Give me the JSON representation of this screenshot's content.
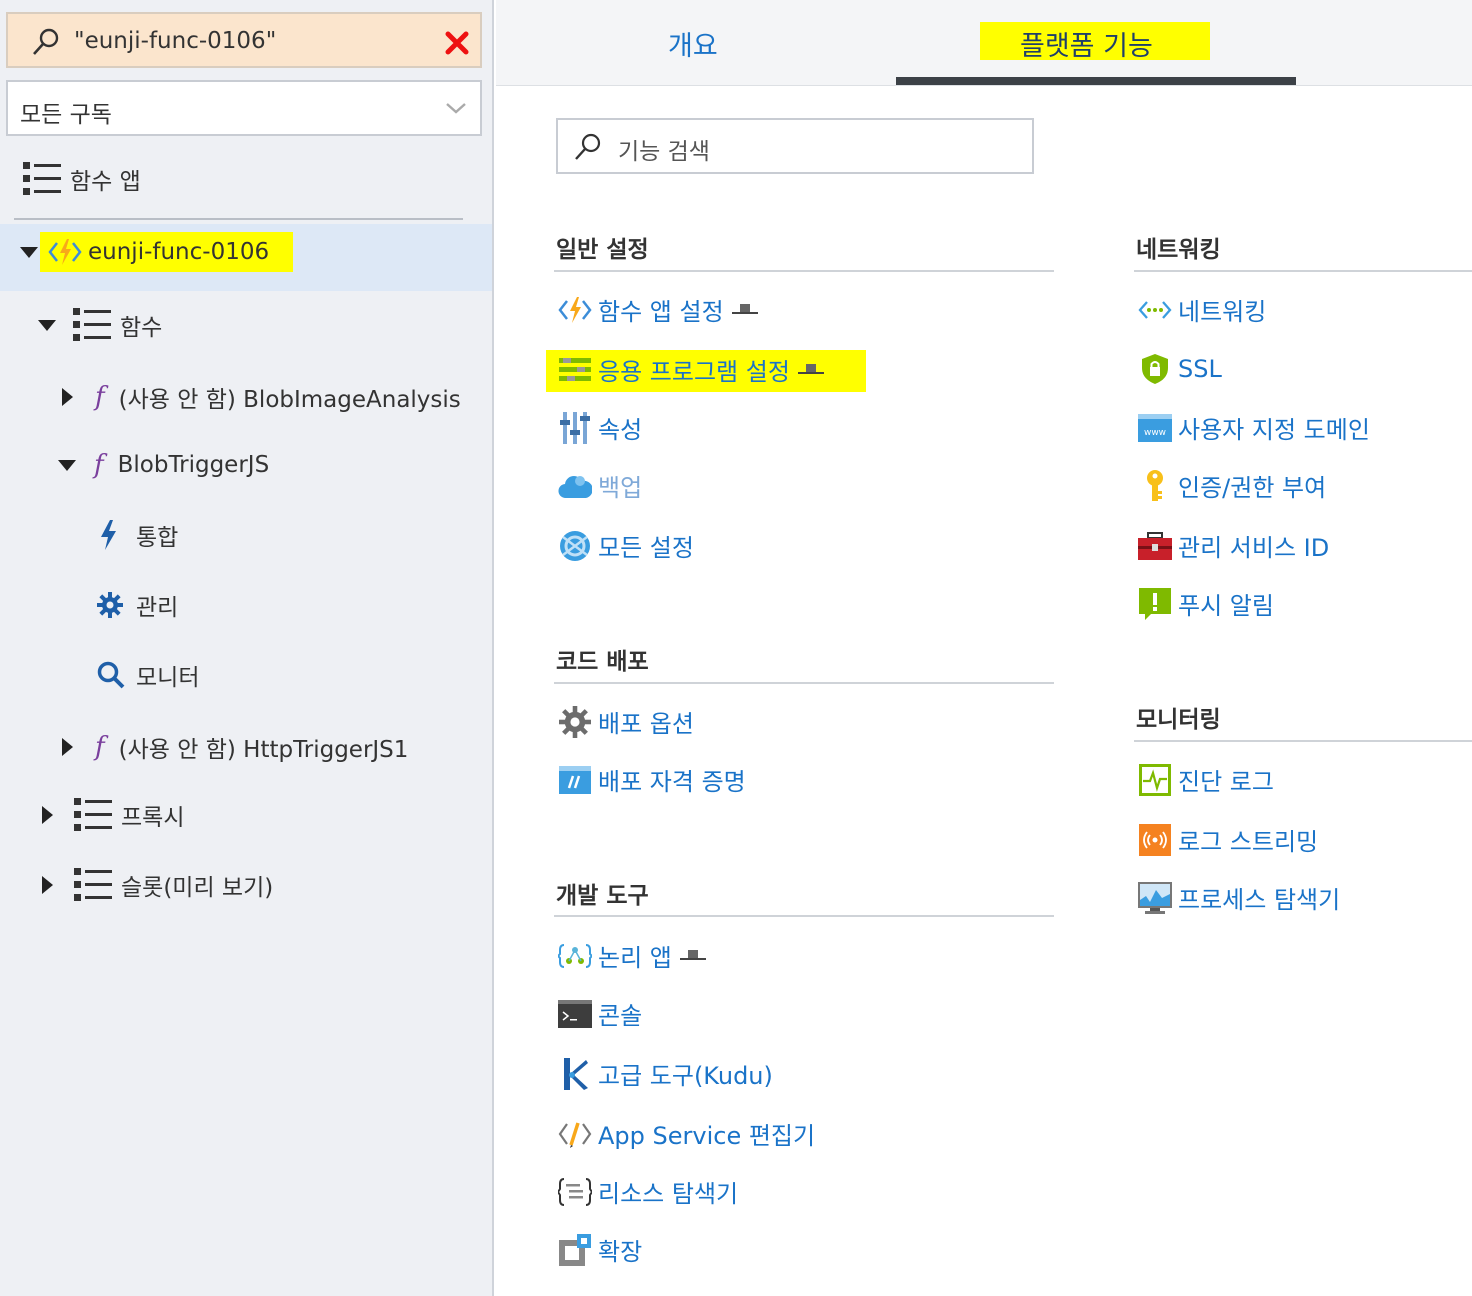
{
  "search": {
    "value": "\"eunji-func-0106\""
  },
  "subscription": {
    "selected": "모든 구독"
  },
  "tree": {
    "root_label": "함수 앱",
    "app_name": "eunji-func-0106",
    "functions_label": "함수",
    "functions": [
      {
        "label": "(사용 안 함) BlobImageAnalysis"
      },
      {
        "label": "BlobTriggerJS"
      },
      {
        "label": "(사용 안 함) HttpTriggerJS1"
      }
    ],
    "function_children": [
      {
        "label": "통합",
        "icon": "lightning-icon"
      },
      {
        "label": "관리",
        "icon": "gear-icon"
      },
      {
        "label": "모니터",
        "icon": "search-icon"
      }
    ],
    "proxies_label": "프록시",
    "slots_label": "슬롯(미리 보기)"
  },
  "tabs": {
    "overview": "개요",
    "platform": "플랫폼 기능"
  },
  "feature_search": {
    "placeholder": "기능 검색"
  },
  "sections": {
    "general": {
      "title": "일반 설정",
      "items": [
        {
          "label": "함수 앱 설정",
          "icon": "function-app-icon"
        },
        {
          "label": "응용 프로그램 설정",
          "icon": "app-settings-icon"
        },
        {
          "label": "속성",
          "icon": "properties-icon"
        },
        {
          "label": "백업",
          "icon": "backup-cloud-icon"
        },
        {
          "label": "모든 설정",
          "icon": "all-settings-icon"
        }
      ]
    },
    "deploy": {
      "title": "코드 배포",
      "items": [
        {
          "label": "배포 옵션",
          "icon": "deploy-gear-icon"
        },
        {
          "label": "배포 자격 증명",
          "icon": "credentials-icon"
        }
      ]
    },
    "devtools": {
      "title": "개발 도구",
      "items": [
        {
          "label": "논리 앱",
          "icon": "logic-app-icon"
        },
        {
          "label": "콘솔",
          "icon": "console-icon"
        },
        {
          "label": "고급 도구(Kudu)",
          "icon": "kudu-icon"
        },
        {
          "label": "App Service 편집기",
          "icon": "editor-icon"
        },
        {
          "label": "리소스 탐색기",
          "icon": "resource-explorer-icon"
        },
        {
          "label": "확장",
          "icon": "extensions-icon"
        }
      ]
    },
    "networking": {
      "title": "네트워킹",
      "items": [
        {
          "label": "네트워킹",
          "icon": "networking-icon"
        },
        {
          "label": "SSL",
          "icon": "ssl-shield-icon"
        },
        {
          "label": "사용자 지정 도메인",
          "icon": "www-icon"
        },
        {
          "label": "인증/권한 부여",
          "icon": "key-icon"
        },
        {
          "label": "관리 서비스 ID",
          "icon": "toolbox-icon"
        },
        {
          "label": "푸시 알림",
          "icon": "push-notification-icon"
        }
      ]
    },
    "monitoring": {
      "title": "모니터링",
      "items": [
        {
          "label": "진단 로그",
          "icon": "diagnostic-logs-icon"
        },
        {
          "label": "로그 스트리밍",
          "icon": "log-streaming-icon"
        },
        {
          "label": "프로세스 탐색기",
          "icon": "process-explorer-icon"
        }
      ]
    }
  },
  "colors": {
    "link": "#1a73c8",
    "highlight": "#ffff00",
    "selected_row": "#dde8f6"
  }
}
